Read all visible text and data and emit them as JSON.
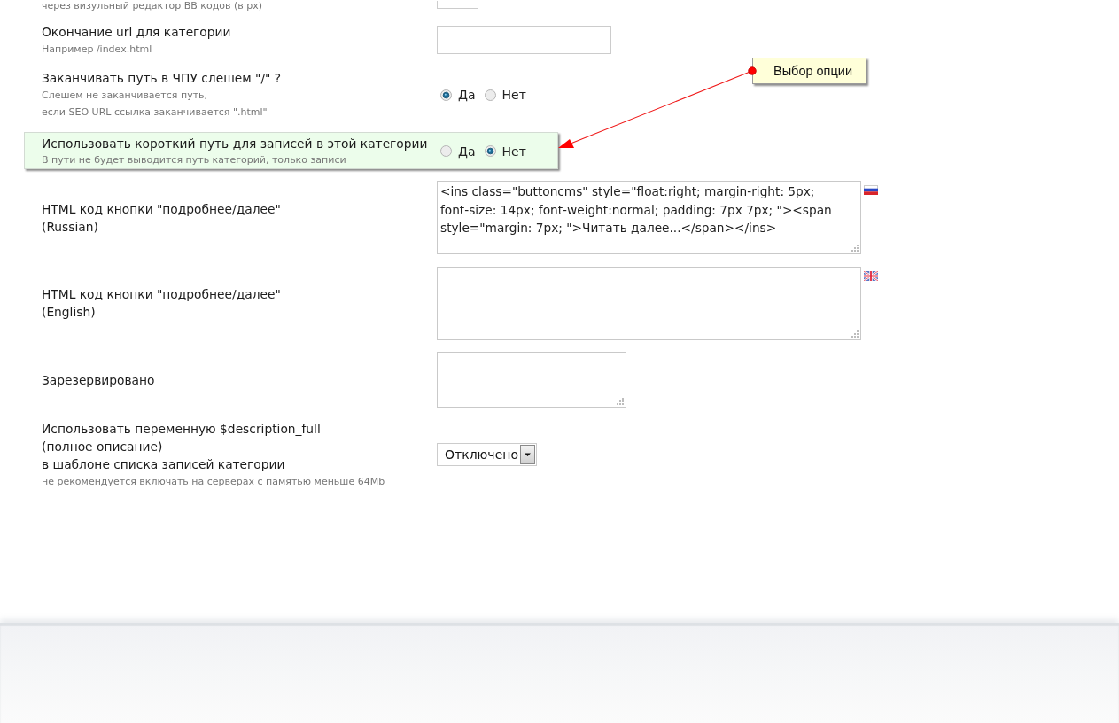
{
  "settings": [
    {
      "kind": "number",
      "highlighted": false,
      "hint": "через визульный редактор BB кодов (в px)"
    },
    {
      "kind": "text",
      "highlighted": false,
      "label": "Окончание url для категории",
      "hint": "Например /index.html"
    },
    {
      "kind": "radio",
      "highlighted": false,
      "label": "Заканчивать путь в ЧПУ слешем \"/\" ?",
      "hint": "Слешем не заканчивается путь,\nесли SEO URL ссылка заканчивается \".html\"",
      "options": [
        {
          "label": "Да",
          "selected": true
        },
        {
          "label": "Нет",
          "selected": false
        }
      ]
    },
    {
      "kind": "radio",
      "highlighted": true,
      "label": "Использовать короткий путь для записей в этой категории",
      "hint": "В пути не будет выводится путь категорий, только записи",
      "options": [
        {
          "label": "Да",
          "selected": false
        },
        {
          "label": "Нет",
          "selected": true
        }
      ]
    },
    {
      "kind": "code",
      "highlighted": false,
      "label": "HTML код кнопки \"подробнее/далее\"\n(Russian)",
      "value": "<ins class=\"buttoncms\" style=\"float:right; margin-right: 5px;\nfont-size: 14px; font-weight:normal; padding: 7px 7px; \"><span style=\"margin: 7px; \">Читать далее...</span></ins>",
      "flag": {
        "kind": "ru"
      }
    },
    {
      "kind": "code",
      "highlighted": false,
      "label": "HTML код кнопки \"подробнее/далее\"\n(English)",
      "flag": {
        "kind": "en"
      }
    },
    {
      "kind": "memo",
      "highlighted": false,
      "label": "Зарезервировано"
    },
    {
      "kind": "select",
      "highlighted": false,
      "label": "Использовать переменную $description_full\n(полное описание)\nв шаблоне списка записей категории",
      "hint": "не рекомендуется включать на серверах с памятью меньше 64Mb",
      "value": "Отключено"
    }
  ],
  "callout": {
    "text": "Выбор опции"
  }
}
